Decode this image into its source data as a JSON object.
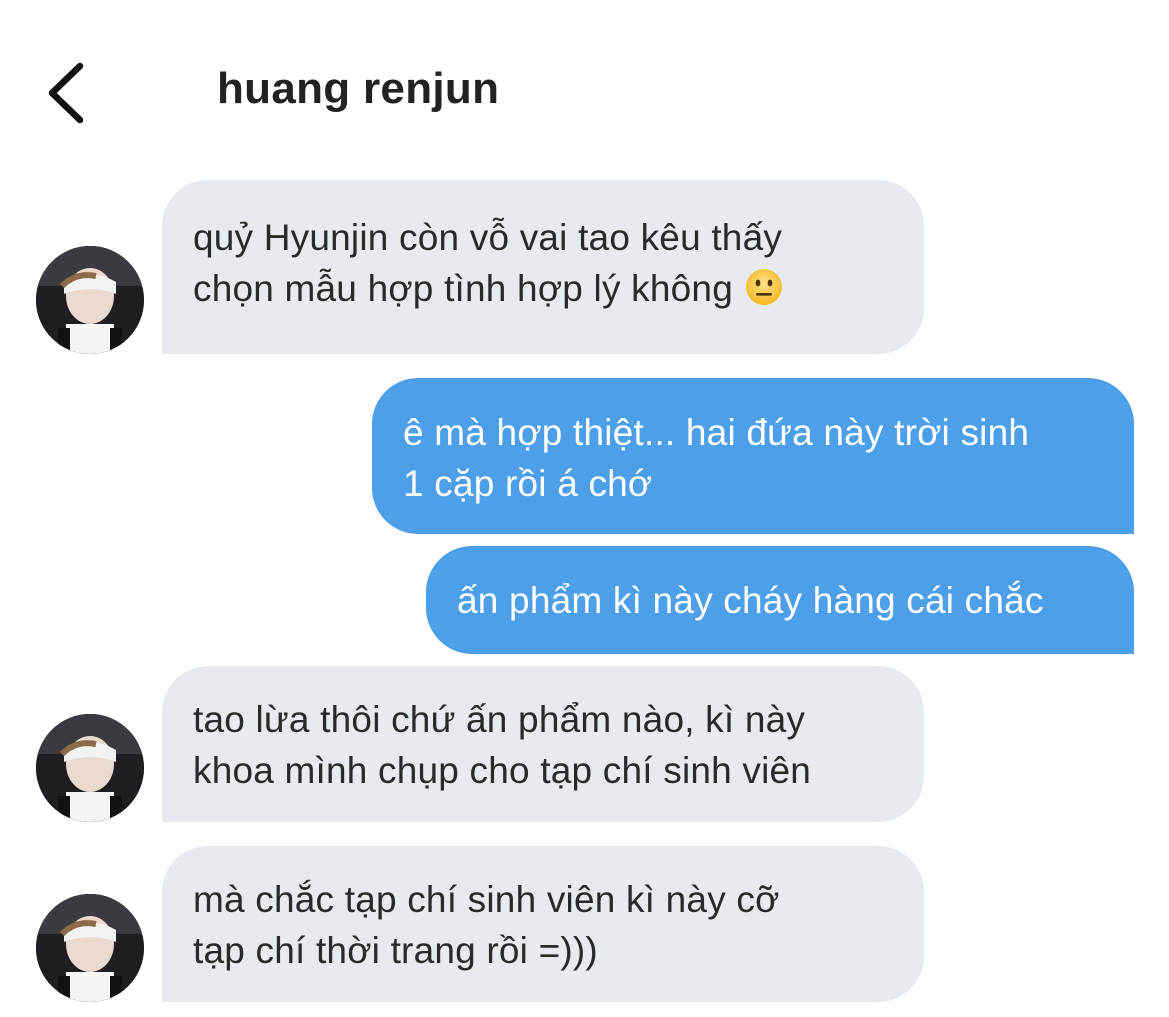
{
  "header": {
    "title": "huang renjun",
    "back_icon": "chevron-left-icon"
  },
  "colors": {
    "incoming_bubble": "#e7ebef",
    "outgoing_bubble": "#4e9fea",
    "outgoing_text": "#ffffff"
  },
  "messages": [
    {
      "direction": "incoming",
      "lines": [
        "quỷ Hyunjin còn vỗ vai tao kêu thấy",
        "chọn mẫu hợp tình hợp lý không"
      ],
      "trailing_emoji": "neutral-face-emoji"
    },
    {
      "direction": "outgoing",
      "lines": [
        "ê mà hợp thiệt... hai đứa này trời sinh",
        "1 cặp rồi á chớ"
      ]
    },
    {
      "direction": "outgoing",
      "lines": [
        "ấn phẩm kì này cháy hàng cái chắc"
      ]
    },
    {
      "direction": "incoming",
      "lines": [
        "tao lừa thôi chứ ấn phẩm nào, kì này",
        "khoa mình chụp cho tạp chí sinh viên"
      ]
    },
    {
      "direction": "incoming",
      "lines": [
        "mà chắc tạp chí sinh viên kì này cỡ",
        "tạp chí thời trang rồi =)))"
      ]
    }
  ]
}
